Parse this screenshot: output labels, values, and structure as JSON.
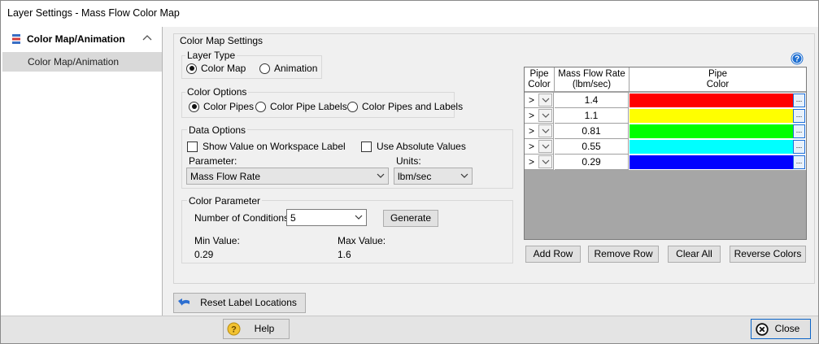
{
  "window": {
    "title": "Layer Settings - Mass Flow Color Map"
  },
  "sidebar": {
    "header": "Color Map/Animation",
    "items": [
      {
        "label": "Color Map/Animation"
      }
    ]
  },
  "main": {
    "title": "Color Map Settings",
    "layer_type": {
      "legend": "Layer Type",
      "options": [
        "Color Map",
        "Animation"
      ],
      "selected": "Color Map"
    },
    "color_options": {
      "legend": "Color Options",
      "options": [
        "Color Pipes",
        "Color Pipe Labels",
        "Color Pipes and Labels"
      ],
      "selected": "Color Pipes"
    },
    "data_options": {
      "legend": "Data Options",
      "show_value_label": "Show Value on Workspace Label",
      "show_value_checked": false,
      "absolute_label": "Use Absolute Values",
      "absolute_checked": false,
      "parameter_label": "Parameter:",
      "parameter_value": "Mass Flow Rate",
      "units_label": "Units:",
      "units_value": "lbm/sec"
    },
    "color_parameter": {
      "legend": "Color Parameter",
      "conditions_label": "Number of Conditions:",
      "conditions_value": "5",
      "generate": "Generate",
      "min_label": "Min Value:",
      "min_value": "0.29",
      "max_label": "Max Value:",
      "max_value": "1.6"
    },
    "grid": {
      "headers": {
        "pipe_color": [
          "Pipe",
          "Color"
        ],
        "flow": [
          "Mass Flow Rate",
          "(lbm/sec)"
        ],
        "swatch": [
          "Pipe",
          "Color"
        ]
      },
      "rows": [
        {
          "op": ">",
          "value": "1.4",
          "color": "#ff0000"
        },
        {
          "op": ">",
          "value": "1.1",
          "color": "#ffff00"
        },
        {
          "op": ">",
          "value": "0.81",
          "color": "#00ff00"
        },
        {
          "op": ">",
          "value": "0.55",
          "color": "#00ffff"
        },
        {
          "op": ">",
          "value": "0.29",
          "color": "#0000ff"
        }
      ],
      "ellipsis": "..."
    },
    "grid_buttons": {
      "add": "Add Row",
      "remove": "Remove Row",
      "clear": "Clear All",
      "reverse": "Reverse Colors"
    },
    "reset_label": "Reset Label Locations"
  },
  "footer": {
    "help": "Help",
    "close": "Close"
  },
  "icons": {
    "help": "question-circle-icon",
    "close": "close-circle-icon",
    "reset": "undo-arrow-icon",
    "sidebar": "layers-icon"
  }
}
